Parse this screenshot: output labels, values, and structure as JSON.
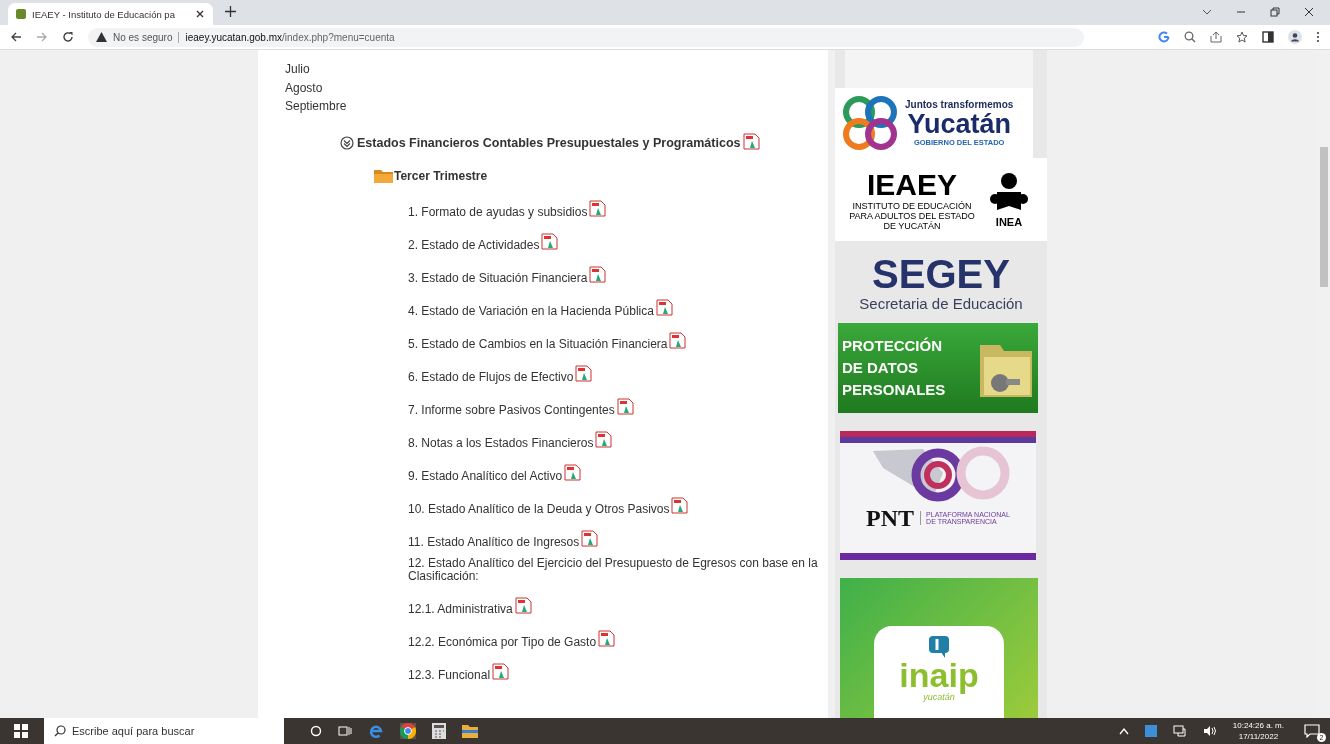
{
  "browser": {
    "tab_title": "IEAEY - Instituto de Educación pa",
    "security_label": "No es seguro",
    "url_domain": "ieaey.yucatan.gob.mx",
    "url_path": "/index.php?menu=cuenta"
  },
  "months": [
    "Julio",
    "Agosto",
    "Septiembre"
  ],
  "section": {
    "title": "Estados Financieros Contables Presupuestales y Programáticos",
    "expanded": true
  },
  "subsection": {
    "title": "Tercer Trimestre"
  },
  "documents": [
    {
      "label": "1. Formato de ayudas y subsidios",
      "pdf": true
    },
    {
      "label": "2. Estado de Actividades",
      "pdf": true
    },
    {
      "label": "3. Estado de Situación Financiera",
      "pdf": true
    },
    {
      "label": "4. Estado de Variación en la Hacienda Pública",
      "pdf": true
    },
    {
      "label": "5. Estado de Cambios en la Situación Financiera",
      "pdf": true
    },
    {
      "label": "6. Estado de Flujos de Efectivo",
      "pdf": true
    },
    {
      "label": "7. Informe sobre Pasivos Contingentes",
      "pdf": true
    },
    {
      "label": "8. Notas a los Estados Financieros",
      "pdf": true
    },
    {
      "label": "9. Estado Analítico del Activo",
      "pdf": true
    },
    {
      "label": "10. Estado Analítico de la Deuda y Otros Pasivos",
      "pdf": true
    },
    {
      "label": "11. Estado Analítico de Ingresos",
      "pdf": true
    },
    {
      "label": "12. Estado Analítico del Ejercicio del Presupuesto de Egresos con base en la Clasificación:",
      "pdf": false
    },
    {
      "label": "12.1. Administrativa",
      "pdf": true
    },
    {
      "label": "12.2. Económica por Tipo de Gasto",
      "pdf": true
    },
    {
      "label": "12.3. Funcional",
      "pdf": true
    }
  ],
  "banners": [
    {
      "kind": "yucatan",
      "lines": [
        "Juntos transformemos",
        "Yucatán",
        "GOBIERNO DEL ESTADO"
      ]
    },
    {
      "kind": "ieaey",
      "lines": [
        "IEAEY",
        "INSTITUTO DE EDUCACIÓN PARA ADULTOS DEL ESTADO DE YUCATÁN",
        "INEA"
      ]
    },
    {
      "kind": "segey",
      "lines": [
        "SEGEY",
        "Secretaria de Educación"
      ]
    },
    {
      "kind": "datos",
      "lines": [
        "PROTECCIÓN",
        "DE DATOS",
        "PERSONALES"
      ]
    },
    {
      "kind": "pnt",
      "lines": [
        "PNT",
        "PLATAFORMA NACIONAL",
        "DE TRANSPARENCIA"
      ]
    },
    {
      "kind": "inaip",
      "lines": [
        "inaip",
        "yucatán"
      ]
    }
  ],
  "taskbar": {
    "search_placeholder": "Escribe aquí para buscar",
    "time": "10:24:26 a. m.",
    "date": "17/11/2022",
    "notifications": "2"
  }
}
